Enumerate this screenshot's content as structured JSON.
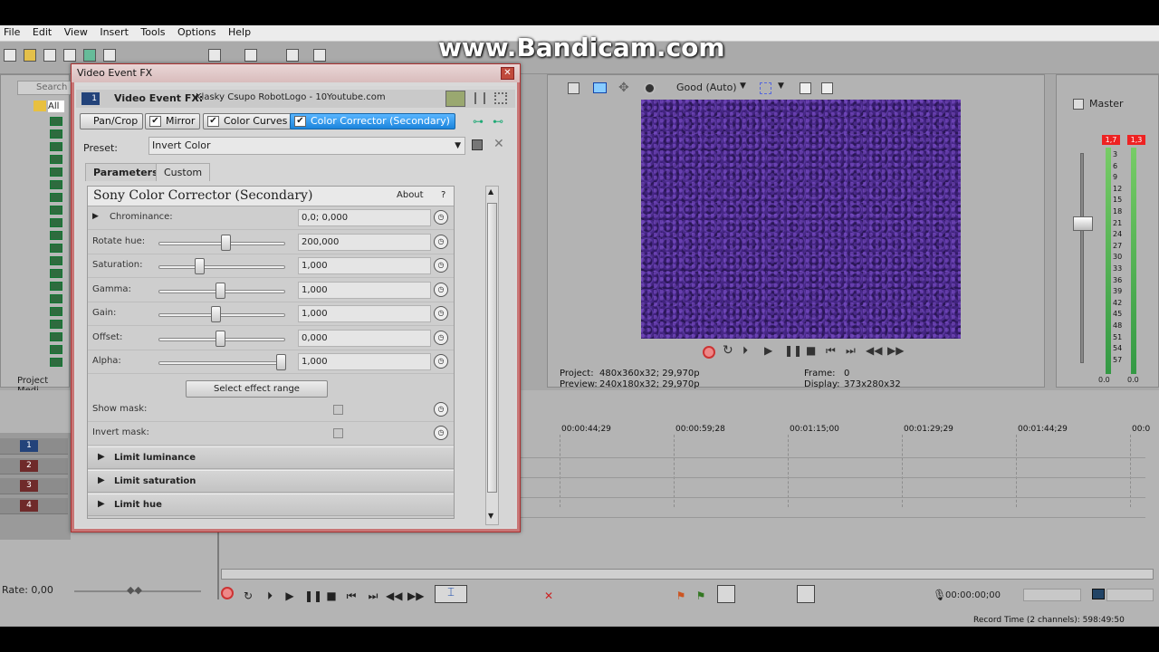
{
  "menu": [
    "File",
    "Edit",
    "View",
    "Insert",
    "Tools",
    "Options",
    "Help"
  ],
  "watermark": "www.Bandicam.com",
  "explorer": {
    "search_placeholder": "Search",
    "all_label": "All",
    "tab_label": "Project Medi"
  },
  "preview": {
    "quality": "Good (Auto)",
    "project_label": "Project:",
    "project_value": "480x360x32; 29,970p",
    "preview_label": "Preview:",
    "preview_value": "240x180x32; 29,970p",
    "frame_label": "Frame:",
    "frame_value": "0",
    "display_label": "Display:",
    "display_value": "373x280x32"
  },
  "mixer": {
    "title": "Master",
    "peak_left": "1,7",
    "peak_right": "1,3",
    "db_ticks": [
      "3",
      "6",
      "9",
      "12",
      "15",
      "18",
      "21",
      "24",
      "27",
      "30",
      "33",
      "36",
      "39",
      "42",
      "45",
      "48",
      "51",
      "54",
      "57"
    ],
    "bottom_left": "0.0",
    "bottom_right": "0.0"
  },
  "timeline": {
    "markers": [
      "00:00:44;29",
      "00:00:59;28",
      "00:01:15;00",
      "00:01:29;29",
      "00:01:44;29",
      "00:0"
    ],
    "tracks": [
      "1",
      "2",
      "3",
      "4"
    ],
    "rate_label": "Rate: 0,00",
    "timecode": "00:00:00;00",
    "record_time": "Record Time (2 channels): 598:49:50"
  },
  "dialog": {
    "title": "Video Event FX",
    "fx_label": "Video Event FX:",
    "fx_name": "Klasky Csupo RobotLogo - 10Youtube.com",
    "track_no": "1",
    "chain": [
      "Pan/Crop",
      "Mirror",
      "Color Curves",
      "Color Corrector (Secondary)"
    ],
    "preset_label": "Preset:",
    "preset_value": "Invert Color",
    "tabs": [
      "Parameters",
      "Custom"
    ],
    "plugin_title": "Sony Color Corrector (Secondary)",
    "about": "About",
    "help": "?",
    "params": [
      {
        "label": "Chrominance:",
        "value": "0,0; 0,000",
        "slider": null
      },
      {
        "label": "Rotate hue:",
        "value": "200,000",
        "slider": 0.55
      },
      {
        "label": "Saturation:",
        "value": "1,000",
        "slider": 0.33
      },
      {
        "label": "Gamma:",
        "value": "1,000",
        "slider": 0.5
      },
      {
        "label": "Gain:",
        "value": "1,000",
        "slider": 0.47
      },
      {
        "label": "Offset:",
        "value": "0,000",
        "slider": 0.5
      },
      {
        "label": "Alpha:",
        "value": "1,000",
        "slider": 1.0
      }
    ],
    "select_range": "Select effect range",
    "show_mask": "Show mask:",
    "invert_mask": "Invert mask:",
    "sections": [
      "Limit luminance",
      "Limit saturation",
      "Limit hue"
    ]
  }
}
